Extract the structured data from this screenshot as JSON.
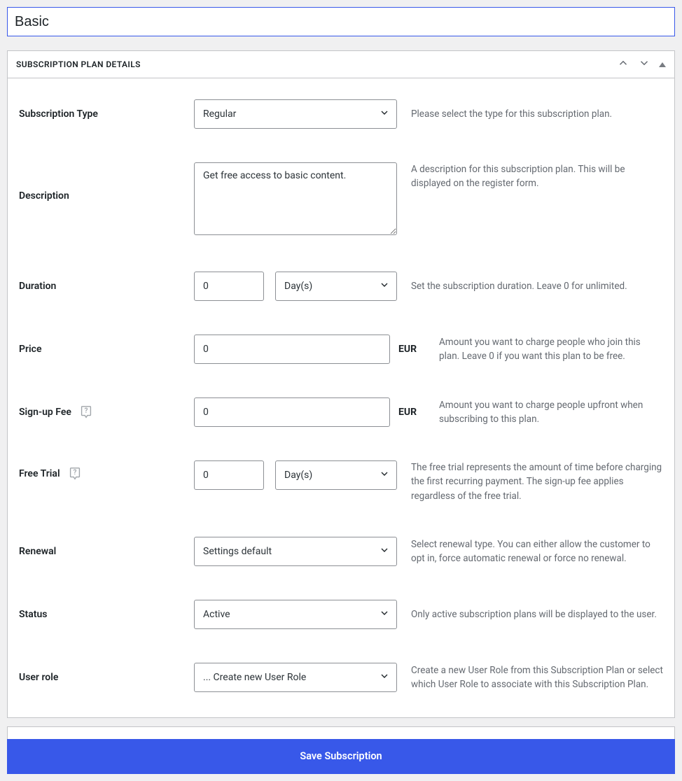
{
  "title_value": "Basic",
  "panel_title": "SUBSCRIPTION PLAN DETAILS",
  "fields": {
    "type": {
      "label": "Subscription Type",
      "value": "Regular",
      "hint": "Please select the type for this subscription plan."
    },
    "description": {
      "label": "Description",
      "value": "Get free access to basic content.",
      "hint": "A description for this subscription plan. This will be displayed on the register form."
    },
    "duration": {
      "label": "Duration",
      "value": "0",
      "unit": "Day(s)",
      "hint": "Set the subscription duration. Leave 0 for unlimited."
    },
    "price": {
      "label": "Price",
      "value": "0",
      "currency": "EUR",
      "hint": "Amount you want to charge people who join this plan. Leave 0 if you want this plan to be free."
    },
    "signup_fee": {
      "label": "Sign-up Fee",
      "value": "0",
      "currency": "EUR",
      "hint": "Amount you want to charge people upfront when subscribing to this plan."
    },
    "free_trial": {
      "label": "Free Trial",
      "value": "0",
      "unit": "Day(s)",
      "hint": "The free trial represents the amount of time before charging the first recurring payment. The sign-up fee applies regardless of the free trial."
    },
    "renewal": {
      "label": "Renewal",
      "value": "Settings default",
      "hint": "Select renewal type. You can either allow the customer to opt in, force automatic renewal or force no renewal."
    },
    "status": {
      "label": "Status",
      "value": "Active",
      "hint": "Only active subscription plans will be displayed to the user."
    },
    "user_role": {
      "label": "User role",
      "value": "... Create new User Role",
      "hint": "Create a new User Role from this Subscription Plan or select which User Role to associate with this Subscription Plan."
    }
  },
  "save_label": "Save Subscription"
}
